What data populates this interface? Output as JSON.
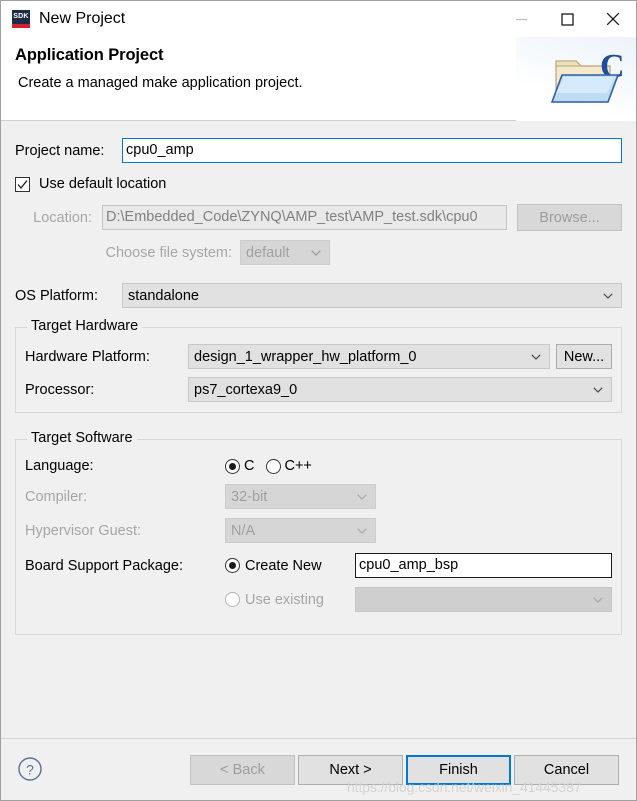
{
  "window": {
    "title": "New Project",
    "app_icon_text": "SDK",
    "controls": {
      "minimize": "minimize-icon",
      "maximize": "maximize-icon",
      "close": "close-icon"
    }
  },
  "header": {
    "title": "Application Project",
    "description": "Create a managed make application project.",
    "icon": "c-project-folder-icon"
  },
  "form": {
    "project_name": {
      "label": "Project name:",
      "value": "cpu0_amp",
      "placeholder": ""
    },
    "use_default_location": {
      "label": "Use default location",
      "checked": true
    },
    "location": {
      "label": "Location:",
      "value": "D:\\Embedded_Code\\ZYNQ\\AMP_test\\AMP_test.sdk\\cpu0",
      "enabled": false
    },
    "browse_button": {
      "label": "Browse...",
      "enabled": false
    },
    "file_system": {
      "label": "Choose file system:",
      "value": "default",
      "enabled": false
    },
    "os_platform": {
      "label": "OS Platform:",
      "value": "standalone"
    }
  },
  "target_hardware": {
    "title": "Target Hardware",
    "hardware_platform": {
      "label": "Hardware Platform:",
      "value": "design_1_wrapper_hw_platform_0"
    },
    "new_button": {
      "label": "New..."
    },
    "processor": {
      "label": "Processor:",
      "value": "ps7_cortexa9_0"
    }
  },
  "target_software": {
    "title": "Target Software",
    "language": {
      "label": "Language:",
      "options": [
        {
          "label": "C",
          "selected": true
        },
        {
          "label": "C++",
          "selected": false
        }
      ]
    },
    "compiler": {
      "label": "Compiler:",
      "value": "32-bit",
      "enabled": false
    },
    "hypervisor_guest": {
      "label": "Hypervisor Guest:",
      "value": "N/A",
      "enabled": false
    },
    "board_support_package": {
      "label": "Board Support Package:",
      "create_new": {
        "label": "Create New",
        "selected": true,
        "value": "cpu0_amp_bsp"
      },
      "use_existing": {
        "label": "Use existing",
        "selected": false,
        "value": "",
        "enabled": false
      }
    }
  },
  "footer": {
    "help_icon": "help-icon",
    "back_button": {
      "label": "< Back",
      "enabled": false
    },
    "next_button": {
      "label": "Next >",
      "enabled": true
    },
    "finish_button": {
      "label": "Finish",
      "enabled": true,
      "focused": true
    },
    "cancel_button": {
      "label": "Cancel",
      "enabled": true
    }
  },
  "watermark": {
    "text": "https://blog.csdn.net/weixin_41445387"
  },
  "colors": {
    "accent": "#0078d7",
    "sdk_icon_bg": "#1c2c47",
    "sdk_icon_stripe": "#d4212c",
    "dialog_bg": "#f0f0f0"
  }
}
